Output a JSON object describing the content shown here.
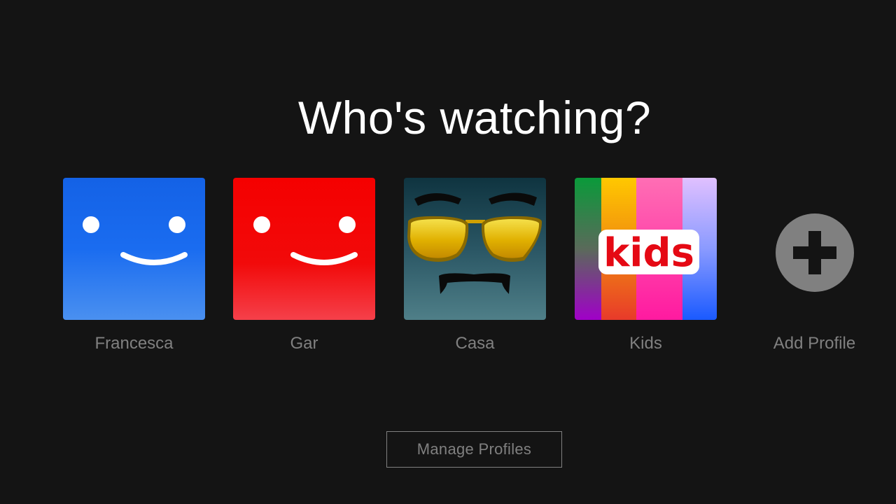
{
  "heading": "Who's watching?",
  "profiles": [
    {
      "name": "Francesca",
      "avatar_icon": "smiley-blue-avatar-icon",
      "color": "#1f72f2"
    },
    {
      "name": "Gar",
      "avatar_icon": "smiley-red-avatar-icon",
      "color": "#f20a0a"
    },
    {
      "name": "Casa",
      "avatar_icon": "sunglasses-mustache-avatar-icon",
      "color": "#2b5f6a"
    },
    {
      "name": "Kids",
      "avatar_icon": "kids-avatar-icon",
      "logo_text": "kids"
    }
  ],
  "add_profile": {
    "label": "Add Profile",
    "icon": "plus-circle-icon"
  },
  "manage_button": {
    "label": "Manage Profiles"
  },
  "colors": {
    "background": "#141414",
    "text_muted": "#808080",
    "heading": "#ffffff"
  }
}
